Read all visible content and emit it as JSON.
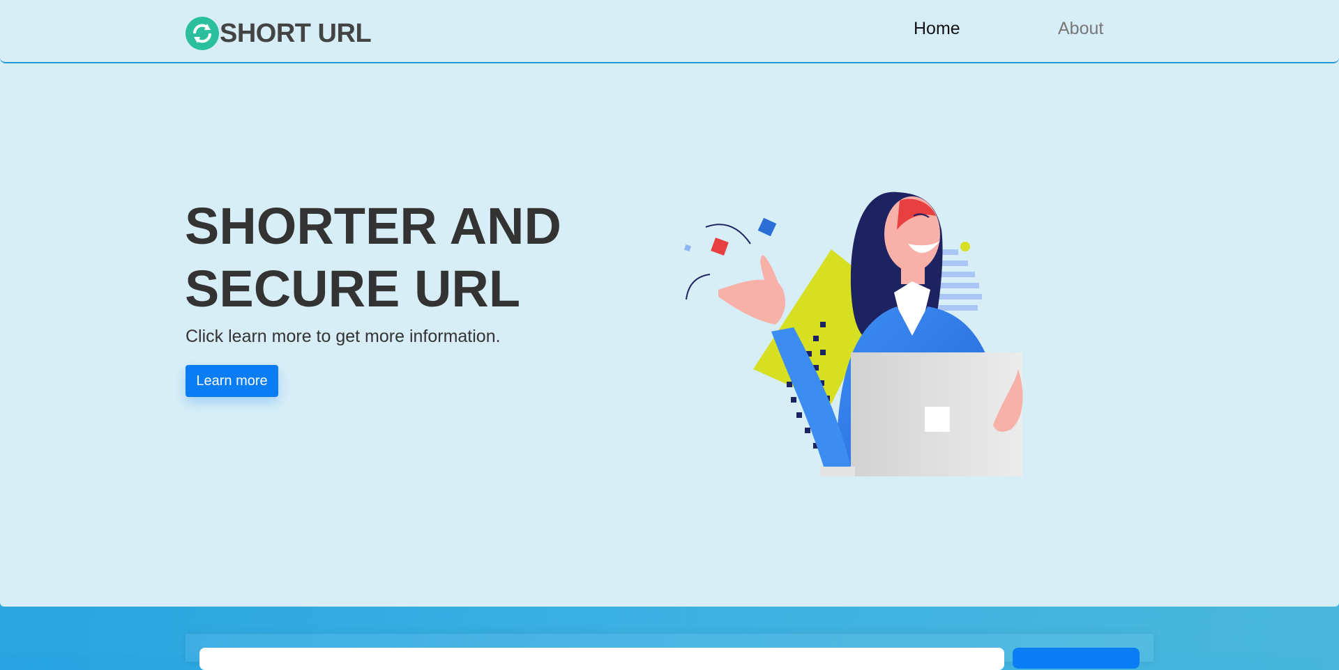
{
  "brand": {
    "name": "SHORT URL",
    "logo_icon": "refresh-icon",
    "logo_color": "#2bbf9d"
  },
  "nav": {
    "home_label": "Home",
    "about_label": "About"
  },
  "hero": {
    "title_line1": "SHORTER AND",
    "title_line2": "SECURE URL",
    "subtitle": "Click learn more to get more information.",
    "cta_label": "Learn more",
    "illustration": "woman-with-laptop-illustration"
  },
  "shorten_form": {
    "input_value": "",
    "button_label": ""
  },
  "colors": {
    "accent": "#0a7df5",
    "hero_bg": "#d7eef7",
    "footer_bg": "#27a3e0"
  }
}
